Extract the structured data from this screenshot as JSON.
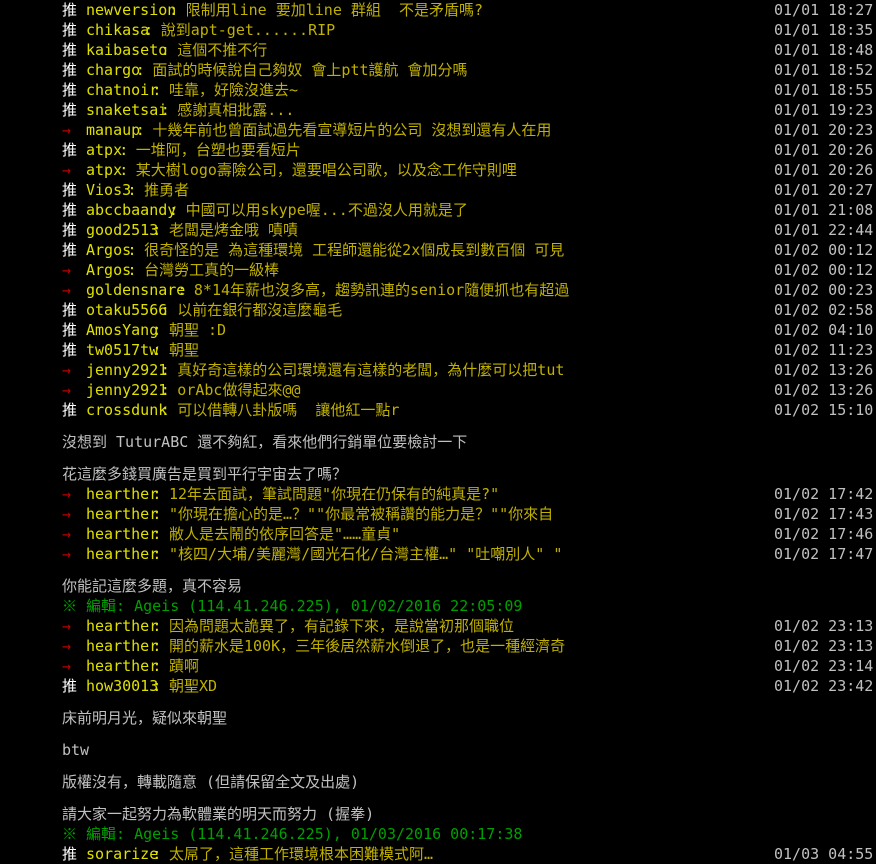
{
  "colors": {
    "background": "#000000",
    "user_id": "#e0e000",
    "comment": "#c0b000",
    "arrow_tag": "#c00000",
    "push_tag": "#ffffff",
    "edit_note": "#00a000",
    "plain_text": "#c0c0c0"
  },
  "lines": [
    {
      "kind": "push",
      "tag": "推",
      "user": "newversion",
      "text": "限制用line 要加line 群組  不是矛盾嗎?",
      "time": "01/01 18:27"
    },
    {
      "kind": "push",
      "tag": "推",
      "user": "chikasa",
      "text": "說到apt-get......RIP",
      "time": "01/01 18:35"
    },
    {
      "kind": "push",
      "tag": "推",
      "user": "kaibaseto",
      "text": "這個不推不行",
      "time": "01/01 18:48"
    },
    {
      "kind": "push",
      "tag": "推",
      "user": "chargo",
      "text": "面試的時候說自己夠奴 會上ptt護航 會加分嗎",
      "time": "01/01 18:52"
    },
    {
      "kind": "push",
      "tag": "推",
      "user": "chatnoir",
      "text": "哇靠，好險沒進去~",
      "time": "01/01 18:55"
    },
    {
      "kind": "push",
      "tag": "推",
      "user": "snaketsai",
      "text": "感謝真相批露...",
      "time": "01/01 19:23"
    },
    {
      "kind": "arrow",
      "tag": "→",
      "user": "manaup",
      "text": "十幾年前也曾面試過先看宣導短片的公司 沒想到還有人在用",
      "time": "01/01 20:23"
    },
    {
      "kind": "push",
      "tag": "推",
      "user": "atpx",
      "text": "一堆阿，台塑也要看短片",
      "time": "01/01 20:26"
    },
    {
      "kind": "arrow",
      "tag": "→",
      "user": "atpx",
      "text": "某大樹logo壽險公司，還要唱公司歌，以及念工作守則哩",
      "time": "01/01 20:26"
    },
    {
      "kind": "push",
      "tag": "推",
      "user": "Vios3",
      "text": "推勇者",
      "time": "01/01 20:27"
    },
    {
      "kind": "push",
      "tag": "推",
      "user": "abccbaandy",
      "text": "中國可以用skype喔...不過沒人用就是了",
      "time": "01/01 21:08"
    },
    {
      "kind": "push",
      "tag": "推",
      "user": "good2513",
      "text": "老闆是烤金哦 嘖嘖",
      "time": "01/01 22:44"
    },
    {
      "kind": "push",
      "tag": "推",
      "user": "Argos",
      "text": "很奇怪的是 為這種環境 工程師還能從2x個成長到數百個 可見",
      "time": "01/02 00:12"
    },
    {
      "kind": "arrow",
      "tag": "→",
      "user": "Argos",
      "text": "台灣勞工真的一級棒",
      "time": "01/02 00:12"
    },
    {
      "kind": "arrow",
      "tag": "→",
      "user": "goldensnare",
      "text": "8*14年薪也沒多高，趨勢訊連的senior隨便抓也有超過",
      "time": "01/02 00:23"
    },
    {
      "kind": "push",
      "tag": "推",
      "user": "otaku5566",
      "text": "以前在銀行都沒這麼龜毛",
      "time": "01/02 02:58"
    },
    {
      "kind": "push",
      "tag": "推",
      "user": "AmosYang",
      "text": "朝聖 :D",
      "time": "01/02 04:10"
    },
    {
      "kind": "push",
      "tag": "推",
      "user": "tw0517tw",
      "text": "朝聖",
      "time": "01/02 11:23"
    },
    {
      "kind": "arrow",
      "tag": "→",
      "user": "jenny2921",
      "text": "真好奇這樣的公司環境還有這樣的老闆，為什麼可以把tut",
      "time": "01/02 13:26"
    },
    {
      "kind": "arrow",
      "tag": "→",
      "user": "jenny2921",
      "text": "orAbc做得起來@@",
      "time": "01/02 13:26"
    },
    {
      "kind": "push",
      "tag": "推",
      "user": "crossdunk",
      "text": "可以借轉八卦版嗎  讓他紅一點r",
      "time": "01/02 15:10"
    },
    {
      "kind": "blank"
    },
    {
      "kind": "plain",
      "text": "沒想到 TuturABC 還不夠紅，看來他們行銷單位要檢討一下"
    },
    {
      "kind": "blank"
    },
    {
      "kind": "plain",
      "text": "花這麼多錢買廣告是買到平行宇宙去了嗎？"
    },
    {
      "kind": "arrow",
      "tag": "→",
      "user": "hearther",
      "text": "12年去面試，筆試問題\"你現在仍保有的純真是?\"",
      "time": "01/02 17:42"
    },
    {
      "kind": "arrow",
      "tag": "→",
      "user": "hearther",
      "text": "\"你現在擔心的是…？\"\"你最常被稱讚的能力是？\"\"你來自",
      "time": "01/02 17:43"
    },
    {
      "kind": "arrow",
      "tag": "→",
      "user": "hearther",
      "text": "敝人是去鬧的依序回答是\"……童貞\"",
      "time": "01/02 17:46"
    },
    {
      "kind": "arrow",
      "tag": "→",
      "user": "hearther",
      "text": "\"核四/大埔/美麗灣/國光石化/台灣主權…\" \"吐嘲別人\" \"",
      "time": "01/02 17:47"
    },
    {
      "kind": "blank"
    },
    {
      "kind": "plain",
      "text": "你能記這麼多題，真不容易"
    },
    {
      "kind": "edit",
      "text": "※ 編輯: Ageis (114.41.246.225), 01/02/2016 22:05:09"
    },
    {
      "kind": "arrow",
      "tag": "→",
      "user": "hearther",
      "text": "因為問題太詭異了，有記錄下來，是說當初那個職位",
      "time": "01/02 23:13"
    },
    {
      "kind": "arrow",
      "tag": "→",
      "user": "hearther",
      "text": "開的薪水是100K，三年後居然薪水倒退了，也是一種經濟奇",
      "time": "01/02 23:13"
    },
    {
      "kind": "arrow",
      "tag": "→",
      "user": "hearther",
      "text": "蹟啊",
      "time": "01/02 23:14"
    },
    {
      "kind": "push",
      "tag": "推",
      "user": "how30013",
      "text": "朝聖XD",
      "time": "01/02 23:42"
    },
    {
      "kind": "blank"
    },
    {
      "kind": "plain",
      "text": "床前明月光，疑似來朝聖"
    },
    {
      "kind": "blank"
    },
    {
      "kind": "plain",
      "text": "btw"
    },
    {
      "kind": "blank"
    },
    {
      "kind": "plain",
      "text": "版權沒有，轉載隨意 (但請保留全文及出處)"
    },
    {
      "kind": "blank"
    },
    {
      "kind": "plain",
      "text": "請大家一起努力為軟體業的明天而努力 (握拳)"
    },
    {
      "kind": "edit",
      "text": "※ 編輯: Ageis (114.41.246.225), 01/03/2016 00:17:38"
    },
    {
      "kind": "push",
      "tag": "推",
      "user": "sorarize",
      "text": "太屌了，這種工作環境根本困難模式阿…",
      "time": "01/03 04:55"
    }
  ]
}
